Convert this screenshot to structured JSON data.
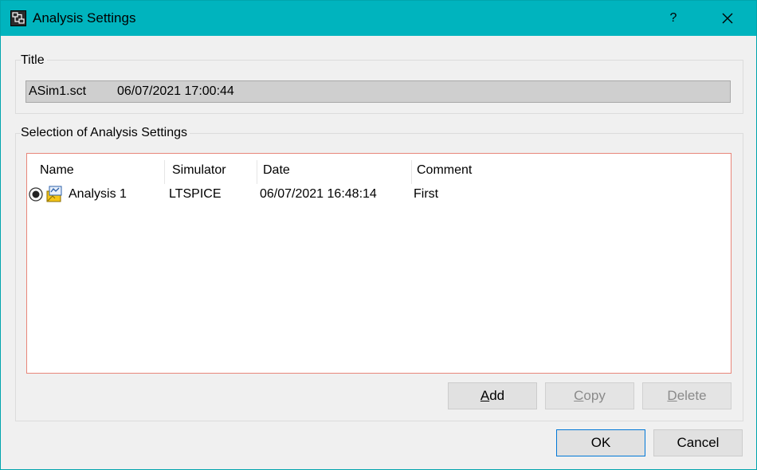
{
  "window": {
    "title": "Analysis Settings",
    "help": "?",
    "icons": {
      "app": "schematic-app-icon",
      "close": "close-icon"
    }
  },
  "title_group": {
    "label": "Title",
    "file": "ASim1.sct",
    "datetime": "06/07/2021 17:00:44"
  },
  "selection_group": {
    "label": "Selection of Analysis Settings",
    "columns": [
      "Name",
      "Simulator",
      "Date",
      "Comment"
    ],
    "rows": [
      {
        "selected": true,
        "icon": "analysis-icon",
        "name": "Analysis 1",
        "simulator": "LTSPICE",
        "date": "06/07/2021 16:48:14",
        "comment": "First"
      }
    ]
  },
  "buttons": {
    "add": {
      "mnemonic": "A",
      "rest": "dd",
      "enabled": true
    },
    "copy": {
      "mnemonic": "C",
      "rest": "opy",
      "enabled": false
    },
    "delete": {
      "mnemonic": "D",
      "rest": "elete",
      "enabled": false
    },
    "ok": "OK",
    "cancel": "Cancel"
  },
  "colors": {
    "titlebar": "#00b4be",
    "list_border": "#e8867a",
    "default_button_border": "#0078d7"
  }
}
